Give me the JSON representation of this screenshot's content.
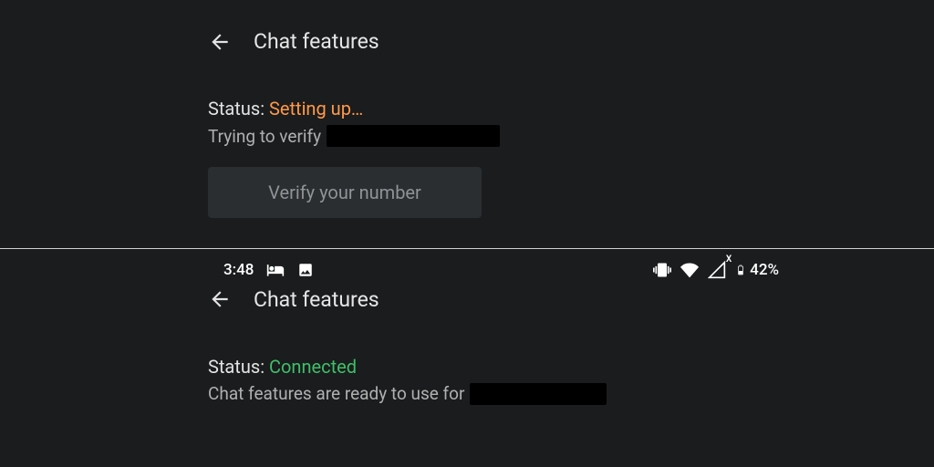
{
  "top": {
    "title": "Chat features",
    "status_prefix": "Status: ",
    "status_value": "Setting up…",
    "subline_text": "Trying to verify",
    "verify_button_label": "Verify your number"
  },
  "bottom": {
    "statusbar": {
      "time": "3:48",
      "battery_text": "42%"
    },
    "title": "Chat features",
    "status_prefix": "Status: ",
    "status_value": "Connected",
    "subline_text": "Chat features are ready to use for"
  }
}
